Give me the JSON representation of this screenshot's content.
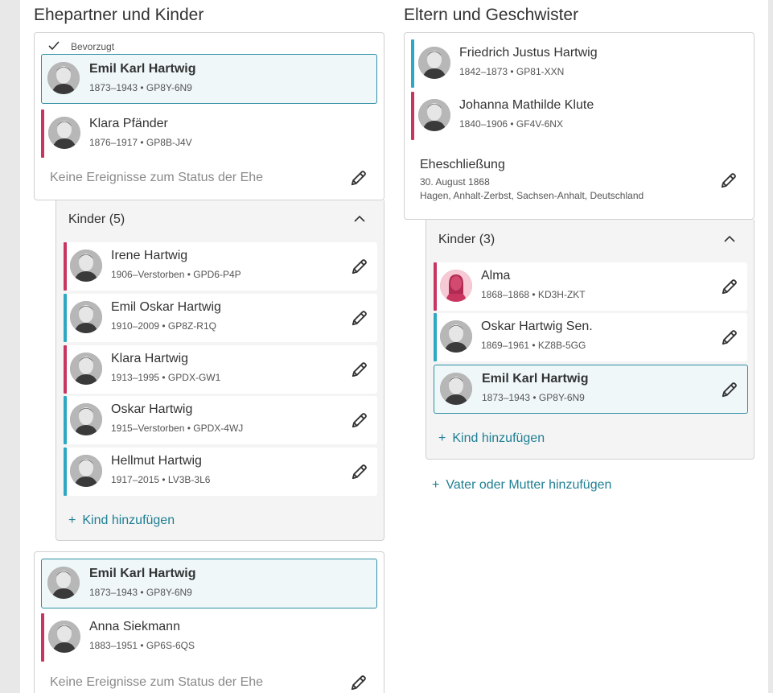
{
  "left": {
    "title": "Ehepartner und Kinder",
    "family1": {
      "preferred_label": "Bevorzugt",
      "husband": {
        "name": "Emil Karl Hartwig",
        "meta": "1873–1943 • GP8Y-6N9"
      },
      "wife": {
        "name": "Klara Pfänder",
        "meta": "1876–1917 • GP8B-J4V"
      },
      "no_events": "Keine Ereignisse zum Status der Ehe",
      "children_header": "Kinder (5)",
      "children": [
        {
          "name": "Irene Hartwig",
          "meta": "1906–Verstorben • GPD6-P4P"
        },
        {
          "name": "Emil Oskar Hartwig",
          "meta": "1910–2009 • GP8Z-R1Q"
        },
        {
          "name": "Klara Hartwig",
          "meta": "1913–1995 • GPDX-GW1"
        },
        {
          "name": "Oskar Hartwig",
          "meta": "1915–Verstorben • GPDX-4WJ"
        },
        {
          "name": "Hellmut Hartwig",
          "meta": "1917–2015 • LV3B-3L6"
        }
      ],
      "add_child": "Kind hinzufügen"
    },
    "family2": {
      "husband": {
        "name": "Emil Karl Hartwig",
        "meta": "1873–1943 • GP8Y-6N9"
      },
      "wife": {
        "name": "Anna Siekmann",
        "meta": "1883–1951 • GP6S-6QS"
      },
      "no_events": "Keine Ereignisse zum Status der Ehe"
    }
  },
  "right": {
    "title": "Eltern und Geschwister",
    "father": {
      "name": "Friedrich Justus Hartwig",
      "meta": "1842–1873 • GP81-XXN"
    },
    "mother": {
      "name": "Johanna Mathilde Klute",
      "meta": "1840–1906 • GF4V-6NX"
    },
    "marriage": {
      "label": "Eheschließung",
      "date": "30. August 1868",
      "place": "Hagen, Anhalt-Zerbst, Sachsen-Anhalt, Deutschland"
    },
    "children_header": "Kinder (3)",
    "children": [
      {
        "name": "Alma",
        "meta": "1868–1868 • KD3H-ZKT"
      },
      {
        "name": "Oskar Hartwig Sen.",
        "meta": "1869–1961 • KZ8B-5GG"
      },
      {
        "name": "Emil Karl Hartwig",
        "meta": "1873–1943 • GP8Y-6N9"
      }
    ],
    "add_child": "Kind hinzufügen",
    "add_parent": "Vater oder Mutter hinzufügen"
  },
  "colors": {
    "female": "#c8365f",
    "male": "#2ca8c3",
    "link": "#1f7f93",
    "selected_border": "#2e8fa3"
  },
  "icons": {
    "edit": "pencil-icon",
    "preferred": "check-icon",
    "add": "plus-icon",
    "collapse": "chevron-up-icon"
  }
}
